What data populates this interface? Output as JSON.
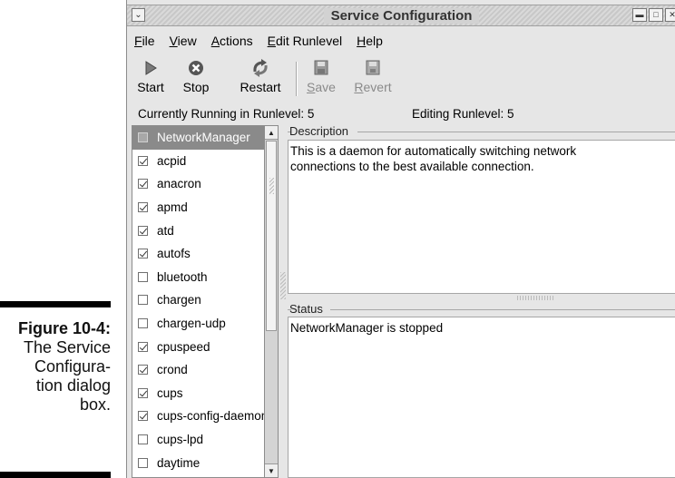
{
  "caption": {
    "label": "Figure 10-4:",
    "lines": [
      "The Service",
      "Configura-",
      "tion dialog",
      "box."
    ]
  },
  "window": {
    "title": "Service Configuration",
    "title_buttons": [
      "minimize-icon",
      "maximize-icon",
      "close-icon"
    ]
  },
  "menu": [
    {
      "prefix": "",
      "key": "F",
      "rest": "ile"
    },
    {
      "prefix": "",
      "key": "V",
      "rest": "iew"
    },
    {
      "prefix": "",
      "key": "A",
      "rest": "ctions"
    },
    {
      "prefix": "",
      "key": "E",
      "rest": "dit Runlevel"
    },
    {
      "prefix": "",
      "key": "H",
      "rest": "elp"
    }
  ],
  "toolbar": {
    "start": "Start",
    "stop": "Stop",
    "restart": "Restart",
    "save_key": "S",
    "save_rest": "ave",
    "revert_key": "R",
    "revert_rest": "evert"
  },
  "status_line": {
    "running": "Currently Running in Runlevel: 5",
    "editing": "Editing Runlevel: 5"
  },
  "services": [
    {
      "name": "NetworkManager",
      "checked": false,
      "selected": true
    },
    {
      "name": "acpid",
      "checked": true
    },
    {
      "name": "anacron",
      "checked": true
    },
    {
      "name": "apmd",
      "checked": true
    },
    {
      "name": "atd",
      "checked": true
    },
    {
      "name": "autofs",
      "checked": true
    },
    {
      "name": "bluetooth",
      "checked": false
    },
    {
      "name": "chargen",
      "checked": false
    },
    {
      "name": "chargen-udp",
      "checked": false
    },
    {
      "name": "cpuspeed",
      "checked": true
    },
    {
      "name": "crond",
      "checked": true
    },
    {
      "name": "cups",
      "checked": true
    },
    {
      "name": "cups-config-daemon",
      "checked": true
    },
    {
      "name": "cups-lpd",
      "checked": false
    },
    {
      "name": "daytime",
      "checked": false
    },
    {
      "name": "",
      "checked": false
    }
  ],
  "description": {
    "heading": "Description",
    "text": "This is a daemon for automatically switching network connections to the best available connection."
  },
  "status": {
    "heading": "Status",
    "text": "NetworkManager is stopped"
  }
}
